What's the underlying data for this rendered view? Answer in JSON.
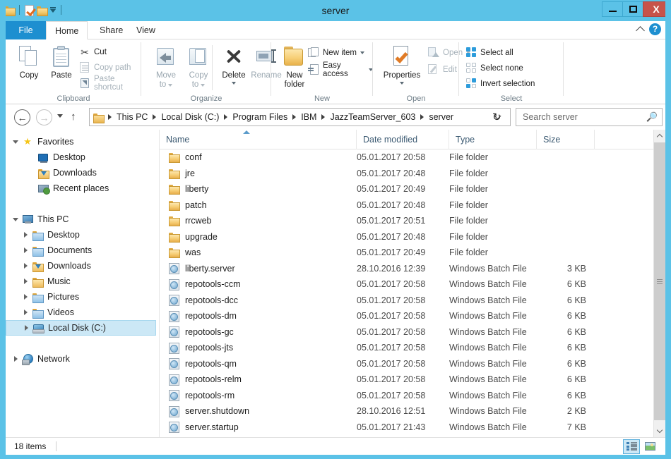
{
  "window": {
    "title": "server",
    "minimize_label": "Minimize",
    "maximize_label": "Maximize",
    "close_label": "X"
  },
  "quick_access": {
    "items": [
      {
        "name": "folder-icon",
        "label": "Folder"
      },
      {
        "name": "properties-icon",
        "label": "Properties"
      },
      {
        "name": "new-folder-icon",
        "label": "New folder"
      },
      {
        "name": "customize-dropdown-icon",
        "label": "Customize Quick Access Toolbar"
      }
    ]
  },
  "ribbon": {
    "tabs": [
      {
        "label": "File",
        "active": false
      },
      {
        "label": "Home",
        "active": true
      },
      {
        "label": "Share",
        "active": false
      },
      {
        "label": "View",
        "active": false
      }
    ],
    "collapse_label": "Collapse the Ribbon",
    "help_label": "?",
    "groups": [
      {
        "name": "Clipboard",
        "label": "Clipboard",
        "big_buttons": [
          {
            "label": "Copy",
            "enabled": true
          },
          {
            "label": "Paste",
            "enabled": true
          }
        ],
        "small_items": [
          {
            "label": "Cut",
            "enabled": true
          },
          {
            "label": "Copy path",
            "enabled": false
          },
          {
            "label": "Paste shortcut",
            "enabled": false
          }
        ]
      },
      {
        "name": "Organize",
        "label": "Organize",
        "big_buttons": [
          {
            "label": "Move\nto",
            "line1": "Move",
            "line2": "to",
            "enabled": false,
            "dropdown": true
          },
          {
            "label": "Copy\nto",
            "line1": "Copy",
            "line2": "to",
            "enabled": false,
            "dropdown": true
          },
          {
            "label": "Delete",
            "line1": "Delete",
            "line2": "",
            "enabled": true,
            "dropdown": true
          },
          {
            "label": "Rename",
            "line1": "Rename",
            "line2": "",
            "enabled": false,
            "dropdown": false
          }
        ]
      },
      {
        "name": "New",
        "label": "New",
        "big_buttons": [
          {
            "line1": "New",
            "line2": "folder",
            "enabled": true
          }
        ],
        "small_items": [
          {
            "label": "New item",
            "enabled": true,
            "dropdown": true
          },
          {
            "label": "Easy access",
            "enabled": true,
            "dropdown": true
          }
        ]
      },
      {
        "name": "Open",
        "label": "Open",
        "big_buttons": [
          {
            "line1": "Properties",
            "line2": "",
            "enabled": true,
            "dropdown": true
          }
        ],
        "small_items": [
          {
            "label": "Open",
            "enabled": false,
            "dropdown": true
          },
          {
            "label": "Edit",
            "enabled": false,
            "dropdown": false
          }
        ]
      },
      {
        "name": "Select",
        "label": "Select",
        "small_items": [
          {
            "label": "Select all",
            "enabled": true
          },
          {
            "label": "Select none",
            "enabled": true
          },
          {
            "label": "Invert selection",
            "enabled": true
          }
        ]
      }
    ]
  },
  "address_bar": {
    "back_label": "Back",
    "forward_label": "Forward",
    "recent_label": "Recent locations",
    "up_label": "Up",
    "refresh_label": "Refresh",
    "breadcrumbs": [
      "This PC",
      "Local Disk (C:)",
      "Program Files",
      "IBM",
      "JazzTeamServer_603",
      "server"
    ]
  },
  "search": {
    "placeholder": "Search server",
    "value": ""
  },
  "sidebar": {
    "nodes": [
      {
        "label": "Favorites",
        "icon": "star-icon",
        "indent": 0,
        "twisty": "expanded",
        "selected": false
      },
      {
        "label": "Desktop",
        "icon": "desktop-monitor-icon",
        "indent": 1,
        "twisty": "none",
        "selected": false
      },
      {
        "label": "Downloads",
        "icon": "downloads-folder-icon",
        "indent": 1,
        "twisty": "none",
        "selected": false
      },
      {
        "label": "Recent places",
        "icon": "recent-places-icon",
        "indent": 1,
        "twisty": "none",
        "selected": false
      },
      {
        "label": "This PC",
        "icon": "this-pc-icon",
        "indent": 0,
        "twisty": "expanded",
        "selected": false
      },
      {
        "label": "Desktop",
        "icon": "desktop-folder-icon",
        "indent": 1,
        "twisty": "collapsed",
        "selected": false
      },
      {
        "label": "Documents",
        "icon": "documents-folder-icon",
        "indent": 1,
        "twisty": "collapsed",
        "selected": false
      },
      {
        "label": "Downloads",
        "icon": "downloads-folder-icon",
        "indent": 1,
        "twisty": "collapsed",
        "selected": false
      },
      {
        "label": "Music",
        "icon": "music-folder-icon",
        "indent": 1,
        "twisty": "collapsed",
        "selected": false
      },
      {
        "label": "Pictures",
        "icon": "pictures-folder-icon",
        "indent": 1,
        "twisty": "collapsed",
        "selected": false
      },
      {
        "label": "Videos",
        "icon": "videos-folder-icon",
        "indent": 1,
        "twisty": "collapsed",
        "selected": false
      },
      {
        "label": "Local Disk (C:)",
        "icon": "local-disk-icon",
        "indent": 1,
        "twisty": "collapsed",
        "selected": true
      },
      {
        "label": "Network",
        "icon": "network-icon",
        "indent": 0,
        "twisty": "collapsed",
        "selected": false
      }
    ]
  },
  "file_list": {
    "columns": [
      {
        "label": "Name",
        "sorted": "asc"
      },
      {
        "label": "Date modified",
        "sorted": ""
      },
      {
        "label": "Type",
        "sorted": ""
      },
      {
        "label": "Size",
        "sorted": ""
      }
    ],
    "rows": [
      {
        "name": "conf",
        "date": "05.01.2017 20:58",
        "type": "File folder",
        "size": "",
        "icon": "folder-icon"
      },
      {
        "name": "jre",
        "date": "05.01.2017 20:48",
        "type": "File folder",
        "size": "",
        "icon": "folder-icon"
      },
      {
        "name": "liberty",
        "date": "05.01.2017 20:49",
        "type": "File folder",
        "size": "",
        "icon": "folder-icon"
      },
      {
        "name": "patch",
        "date": "05.01.2017 20:48",
        "type": "File folder",
        "size": "",
        "icon": "folder-icon"
      },
      {
        "name": "rrcweb",
        "date": "05.01.2017 20:51",
        "type": "File folder",
        "size": "",
        "icon": "folder-icon"
      },
      {
        "name": "upgrade",
        "date": "05.01.2017 20:48",
        "type": "File folder",
        "size": "",
        "icon": "folder-icon"
      },
      {
        "name": "was",
        "date": "05.01.2017 20:49",
        "type": "File folder",
        "size": "",
        "icon": "folder-icon"
      },
      {
        "name": "liberty.server",
        "date": "28.10.2016 12:39",
        "type": "Windows Batch File",
        "size": "3 KB",
        "icon": "batch-file-icon"
      },
      {
        "name": "repotools-ccm",
        "date": "05.01.2017 20:58",
        "type": "Windows Batch File",
        "size": "6 KB",
        "icon": "batch-file-icon"
      },
      {
        "name": "repotools-dcc",
        "date": "05.01.2017 20:58",
        "type": "Windows Batch File",
        "size": "6 KB",
        "icon": "batch-file-icon"
      },
      {
        "name": "repotools-dm",
        "date": "05.01.2017 20:58",
        "type": "Windows Batch File",
        "size": "6 KB",
        "icon": "batch-file-icon"
      },
      {
        "name": "repotools-gc",
        "date": "05.01.2017 20:58",
        "type": "Windows Batch File",
        "size": "6 KB",
        "icon": "batch-file-icon"
      },
      {
        "name": "repotools-jts",
        "date": "05.01.2017 20:58",
        "type": "Windows Batch File",
        "size": "6 KB",
        "icon": "batch-file-icon"
      },
      {
        "name": "repotools-qm",
        "date": "05.01.2017 20:58",
        "type": "Windows Batch File",
        "size": "6 KB",
        "icon": "batch-file-icon"
      },
      {
        "name": "repotools-relm",
        "date": "05.01.2017 20:58",
        "type": "Windows Batch File",
        "size": "6 KB",
        "icon": "batch-file-icon"
      },
      {
        "name": "repotools-rm",
        "date": "05.01.2017 20:58",
        "type": "Windows Batch File",
        "size": "6 KB",
        "icon": "batch-file-icon"
      },
      {
        "name": "server.shutdown",
        "date": "28.10.2016 12:51",
        "type": "Windows Batch File",
        "size": "2 KB",
        "icon": "batch-file-icon"
      },
      {
        "name": "server.startup",
        "date": "05.01.2017 21:43",
        "type": "Windows Batch File",
        "size": "7 KB",
        "icon": "batch-file-icon"
      }
    ]
  },
  "status_bar": {
    "item_count": "18 items",
    "view_buttons": [
      {
        "name": "details-view-button",
        "label": "Details view",
        "active": true
      },
      {
        "name": "large-icons-view-button",
        "label": "Large icons view",
        "active": false
      }
    ]
  },
  "colors": {
    "accent": "#5bc2e7",
    "file_tab": "#1d8fd0",
    "selection": "#cce8f6",
    "close_button": "#c7534a"
  }
}
